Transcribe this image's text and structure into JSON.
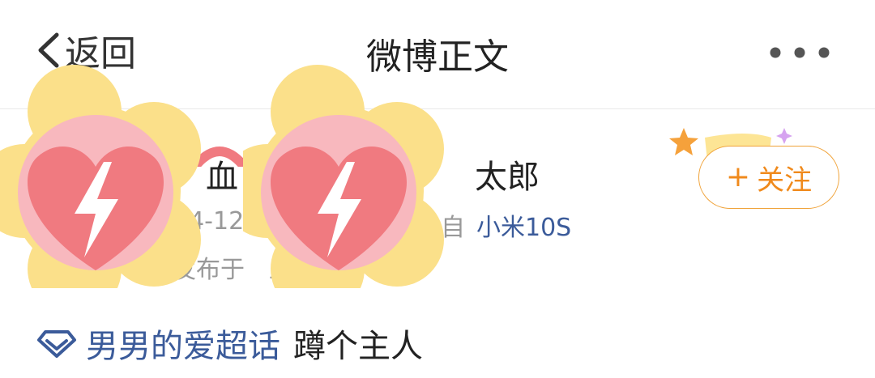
{
  "header": {
    "back_label": "返回",
    "title": "微博正文",
    "more_icon": "more-horizontal-icon"
  },
  "author": {
    "name_fragment_1": "血",
    "name_fragment_2": "太郎",
    "date_fragment": "24-12-",
    "source_prefix": "自",
    "device": "小米10S",
    "location_prefix": "发布于",
    "location_fragment": "上"
  },
  "follow_button": {
    "plus": "+",
    "label": "关注",
    "accent_color": "#f08a1c"
  },
  "post": {
    "topic_icon": "super-topic-diamond-icon",
    "topic": "男男的爱超话",
    "text": "蹲个主人"
  },
  "stickers": [
    {
      "name": "privacy-heart-sticker-left",
      "icon": "lightning-heart-icon"
    },
    {
      "name": "privacy-heart-sticker-right",
      "icon": "lightning-heart-icon"
    }
  ],
  "colors": {
    "link": "#3b5b9a",
    "sticker_yellow": "#fbe08a",
    "sticker_pink": "#f8b8be",
    "heart_red": "#f07a80"
  }
}
